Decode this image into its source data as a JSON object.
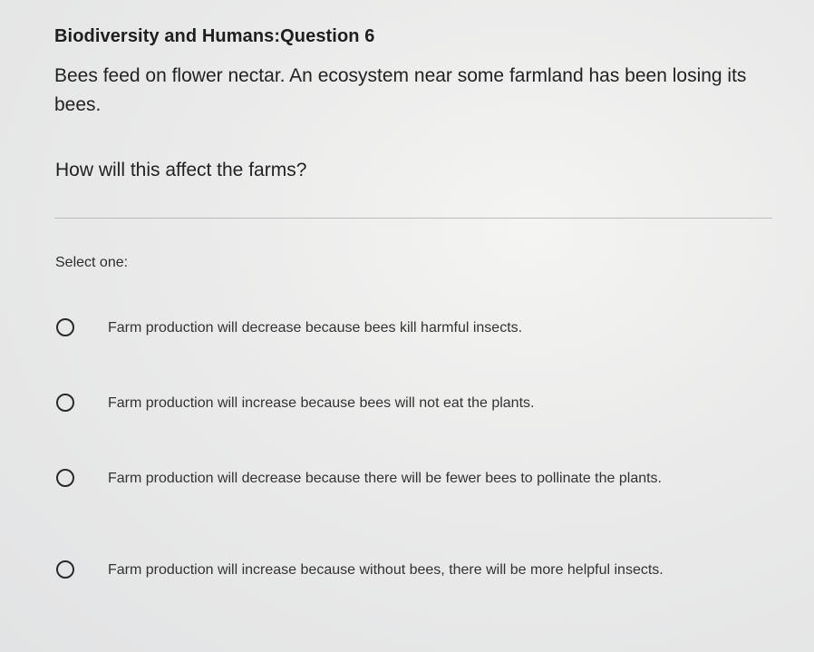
{
  "question": {
    "title": "Biodiversity and Humans:Question 6",
    "text": "Bees feed on flower nectar. An ecosystem near some farmland has been losing its bees.",
    "prompt": "How will this affect the farms?"
  },
  "answer": {
    "select_label": "Select one:",
    "options": [
      {
        "label": "Farm production will decrease because bees kill harmful insects.",
        "selected": false
      },
      {
        "label": "Farm production will increase because bees will not eat the plants.",
        "selected": false
      },
      {
        "label": "Farm production will decrease because there will be fewer bees to pollinate the plants.",
        "selected": false
      },
      {
        "label": "Farm production will increase because without bees, there will be more helpful insects.",
        "selected": false
      }
    ]
  }
}
